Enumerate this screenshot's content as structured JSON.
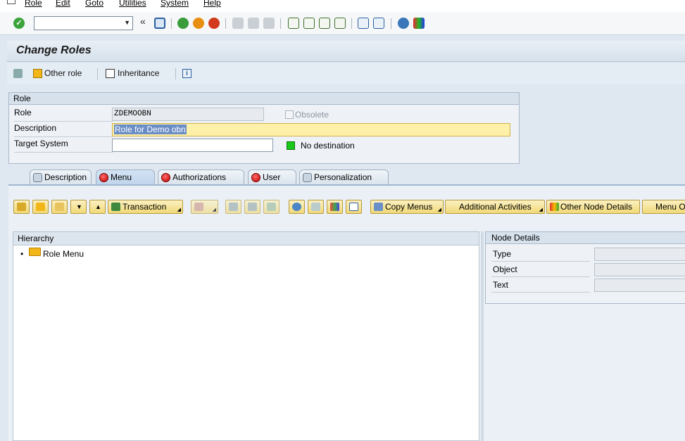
{
  "menubar": {
    "items": [
      "Role",
      "Edit",
      "Goto",
      "Utilities",
      "System",
      "Help"
    ]
  },
  "systoolbar": {
    "command_value": "",
    "icons": [
      "ok-icon",
      "save-icon",
      "back-icon",
      "exit-icon",
      "cancel-icon",
      "print-icon",
      "find-icon",
      "find-next-icon",
      "first-page-icon",
      "prev-page-icon",
      "next-page-icon",
      "last-page-icon",
      "new-session-icon",
      "shortcut-icon",
      "help-icon",
      "layout-icon"
    ]
  },
  "title": "Change Roles",
  "apptoolbar": {
    "other_role": "Other role",
    "inheritance": "Inheritance"
  },
  "role_group": {
    "header": "Role",
    "role_label": "Role",
    "role_value": "ZDEMOOBN",
    "obsolete_label": "Obsolete",
    "description_label": "Description",
    "description_value": "Role for Demo obn",
    "target_system_label": "Target System",
    "target_system_value": "",
    "destination_status": "No destination",
    "destination_color": "#19c919"
  },
  "tabs": [
    {
      "label": "Description",
      "icon": "description-icon"
    },
    {
      "label": "Menu",
      "icon": "red-status-icon"
    },
    {
      "label": "Authorizations",
      "icon": "red-status-icon"
    },
    {
      "label": "User",
      "icon": "red-status-icon"
    },
    {
      "label": "Personalization",
      "icon": "personalization-icon"
    }
  ],
  "menu_toolbar": {
    "transaction": "Transaction",
    "copy_menus": "Copy Menus",
    "additional_activities": "Additional Activities",
    "other_node_details": "Other Node Details",
    "menu_options": "Menu O"
  },
  "hierarchy": {
    "header": "Hierarchy",
    "root": "Role Menu"
  },
  "node_details": {
    "header": "Node Details",
    "type_label": "Type",
    "object_label": "Object",
    "text_label": "Text"
  }
}
